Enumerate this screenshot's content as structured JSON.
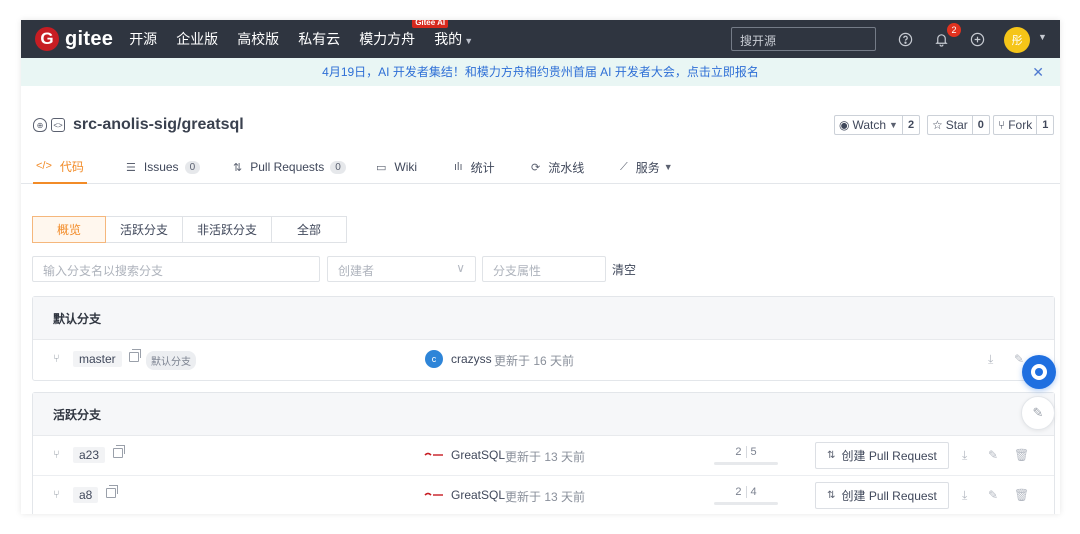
{
  "colors": {
    "nav_bg": "#2f3540",
    "accent": "#f28b27",
    "brand_red": "#c71d23",
    "banner_text": "#2e6fd6",
    "banner_bg": "#e9f6f4"
  },
  "nav": {
    "logo_text": "gitee",
    "items": [
      "开源",
      "企业版",
      "高校版",
      "私有云",
      "模力方舟",
      "我的"
    ],
    "badge": "Gitee AI",
    "search_placeholder": "搜开源",
    "notification_count": "2",
    "avatar_text": "彤",
    "icons": [
      "help-icon",
      "bell-icon",
      "plus-icon"
    ]
  },
  "banner": {
    "text": "4月19日，AI 开发者集结！和模力方舟相约贵州首届 AI 开发者大会，点击立即报名"
  },
  "repo": {
    "title": "src-anolis-sig/greatsql",
    "watch": {
      "label": "Watch",
      "count": "2"
    },
    "star": {
      "label": "Star",
      "count": "0"
    },
    "fork": {
      "label": "Fork",
      "count": "1"
    }
  },
  "tabs": [
    {
      "label": "代码",
      "icon": "code-icon"
    },
    {
      "label": "Issues",
      "count": "0",
      "icon": "issues-icon"
    },
    {
      "label": "Pull Requests",
      "count": "0",
      "icon": "pull-request-icon"
    },
    {
      "label": "Wiki",
      "icon": "book-icon"
    },
    {
      "label": "统计",
      "icon": "chart-icon"
    },
    {
      "label": "流水线",
      "icon": "pipeline-icon"
    },
    {
      "label": "服务",
      "icon": "service-icon"
    }
  ],
  "filter": {
    "segments": [
      "概览",
      "活跃分支",
      "非活跃分支",
      "全部"
    ],
    "search_placeholder": "输入分支名以搜索分支",
    "creator_placeholder": "创建者",
    "attr_placeholder": "分支属性",
    "clear": "清空"
  },
  "default_section": {
    "title": "默认分支",
    "rows": [
      {
        "branch": "master",
        "tag": "默认分支",
        "author_initial": "c",
        "author": "crazyss",
        "updated": "更新于 16 天前"
      }
    ]
  },
  "active_section": {
    "title": "活跃分支",
    "rows": [
      {
        "branch": "a23",
        "author": "GreatSQL",
        "updated": "更新于 13 天前",
        "behind": "2",
        "ahead": "5",
        "pr_label": "创建 Pull Request"
      },
      {
        "branch": "a8",
        "author": "GreatSQL",
        "updated": "更新于 13 天前",
        "behind": "2",
        "ahead": "4",
        "pr_label": "创建 Pull Request"
      }
    ]
  }
}
